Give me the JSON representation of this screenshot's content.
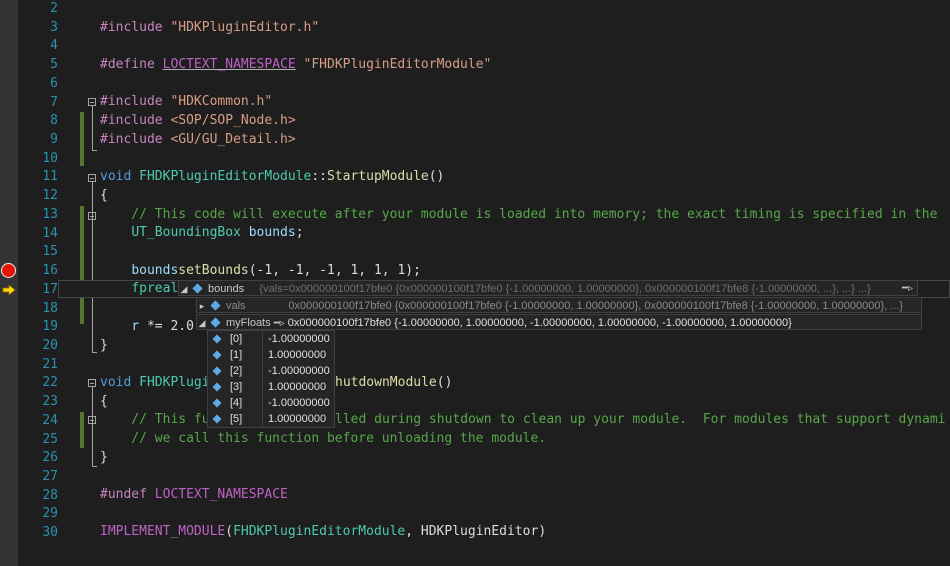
{
  "editor": {
    "line_numbers": [
      "2",
      "3",
      "4",
      "5",
      "6",
      "7",
      "8",
      "9",
      "10",
      "11",
      "12",
      "13",
      "14",
      "15",
      "16",
      "17",
      "18",
      "19",
      "20",
      "21",
      "22",
      "23",
      "24",
      "25",
      "26",
      "27",
      "28",
      "29",
      "30"
    ],
    "lines": {
      "l3": {
        "t1": "#include ",
        "t2": "\"HDKPluginEditor.h\""
      },
      "l5": {
        "t1": "#define ",
        "t2": "LOCTEXT_NAMESPACE",
        "t3": " ",
        "t4": "\"FHDKPluginEditorModule\""
      },
      "l7": {
        "t1": "#include ",
        "t2": "\"HDKCommon.h\""
      },
      "l8": {
        "t1": "#include ",
        "t2": "<SOP/SOP_Node.h>"
      },
      "l9": {
        "t1": "#include ",
        "t2": "<GU/GU_Detail.h>"
      },
      "l11": {
        "t1": "void ",
        "t2": "FHDKPluginEditorModule",
        "t3": "::",
        "t4": "StartupModule",
        "t5": "()"
      },
      "l12": {
        "t1": "{"
      },
      "l13": {
        "t1": "    // This code will execute after your module is loaded into memory; the exact timing is specified in the"
      },
      "l14": {
        "t1": "    ",
        "t2": "UT_BoundingBox",
        "t3": " ",
        "t4": "bounds",
        ";": ";"
      },
      "l16": {
        "t1": "    ",
        "t2": "bounds",
        ".": ".",
        "t3": "setBounds",
        "t4": "(-1, -1, -1, 1, 1, 1);"
      },
      "l17": {
        "t1": "    ",
        "t2": "fpreal"
      },
      "l19": {
        "t1": "    ",
        "t2": "r",
        "t3": " *= 2.0"
      },
      "l20": {
        "t1": "}"
      },
      "l22": {
        "t1": "void ",
        "t2": "FHDKPlugi",
        "t3": "hutdownModule",
        "t4": "()"
      },
      "l23": {
        "t1": "{"
      },
      "l24": {
        "t1": "    // This fu",
        "t2": "lled during shutdown to clean up your module.  For modules that support dynami"
      },
      "l25": {
        "t1": "    // we call this function before unloading the module."
      },
      "l26": {
        "t1": "}"
      },
      "l28": {
        "t1": "#undef ",
        "t2": "LOCTEXT_NAMESPACE"
      },
      "l30": {
        "t1": "IMPLEMENT_MODULE",
        "t2": "(",
        "t3": "FHDKPluginEditorModule",
        ",": ", ",
        "t4": "HDKPluginEditor",
        "t5": ")"
      }
    }
  },
  "datatip": {
    "bounds": {
      "name": "bounds",
      "value": "{vals=0x000000100f17bfe0 {0x000000100f17bfe0 {-1.00000000, 1.00000000}, 0x000000100f17bfe8 {-1.00000000, ...}, ...} ...}"
    },
    "vals": {
      "name": "vals",
      "value": "0x000000100f17bfe0 {0x000000100f17bfe0 {-1.00000000, 1.00000000}, 0x000000100f17bfe8 {-1.00000000, 1.00000000}, ...}"
    },
    "myFloats": {
      "name": "myFloats",
      "value": "0x000000100f17bfe0 {-1.00000000, 1.00000000, -1.00000000, 1.00000000, -1.00000000, 1.00000000}"
    },
    "pin_icon": "pin-icon",
    "array": [
      {
        "index": "[0]",
        "value": "-1.00000000"
      },
      {
        "index": "[1]",
        "value": "1.00000000"
      },
      {
        "index": "[2]",
        "value": "-1.00000000"
      },
      {
        "index": "[3]",
        "value": "1.00000000"
      },
      {
        "index": "[4]",
        "value": "-1.00000000"
      },
      {
        "index": "[5]",
        "value": "1.00000000"
      }
    ]
  },
  "colors": {
    "background": "#1e1e1e",
    "breakpoint": "#e51400",
    "arrow": "#ffd800",
    "line_number": "#2b91af",
    "comment": "#57a64a"
  }
}
